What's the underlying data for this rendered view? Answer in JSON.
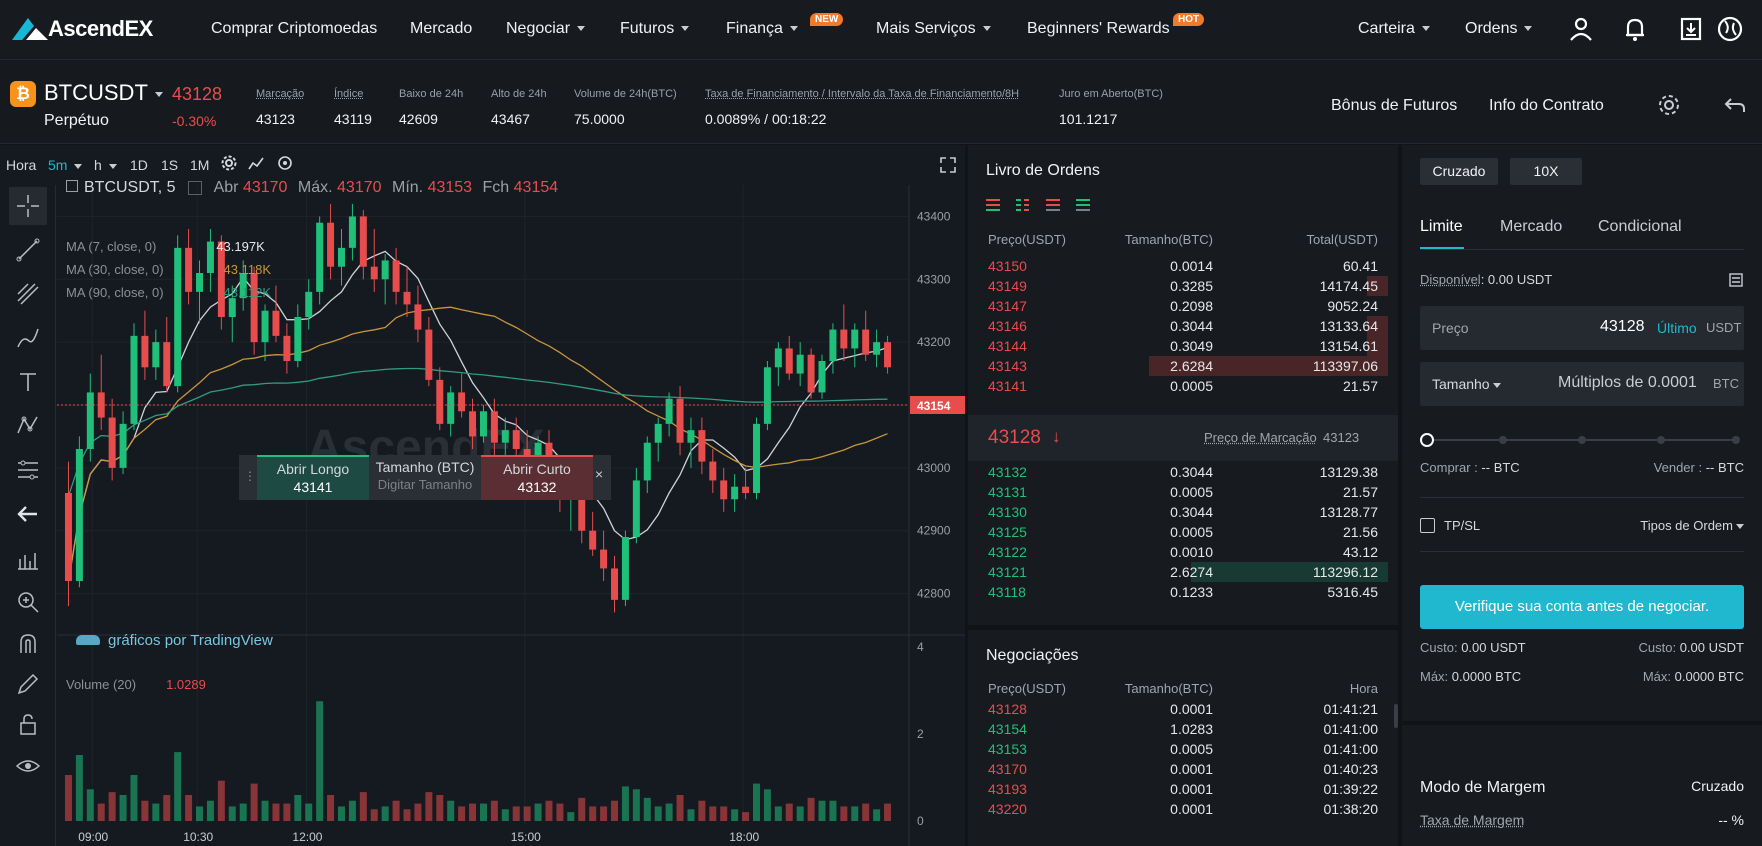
{
  "nav": {
    "logo": "AscendEX",
    "items": [
      {
        "label": "Comprar Criptomoedas"
      },
      {
        "label": "Mercado"
      },
      {
        "label": "Negociar",
        "dropdown": true
      },
      {
        "label": "Futuros",
        "dropdown": true
      },
      {
        "label": "Finança",
        "dropdown": true,
        "badge": "NEW"
      },
      {
        "label": "Mais Serviços",
        "dropdown": true
      },
      {
        "label": "Beginners' Rewards",
        "badge": "HOT"
      }
    ],
    "right": [
      {
        "label": "Carteira"
      },
      {
        "label": "Ordens"
      }
    ],
    "icons": [
      "user-icon",
      "bell-icon",
      "download-icon",
      "globe-icon"
    ]
  },
  "ticker": {
    "symbol": "BTCUSDT",
    "type": "Perpétuo",
    "price": "43128",
    "change": "-0.30%",
    "stats": [
      {
        "label": "Marcação",
        "value": "43123"
      },
      {
        "label": "Índice",
        "value": "43119"
      },
      {
        "label": "Baixo de 24h",
        "value": "42609"
      },
      {
        "label": "Alto de 24h",
        "value": "43467"
      },
      {
        "label": "Volume de 24h(BTC)",
        "value": "75.0000"
      },
      {
        "label": "Taxa de Financiamento / Intervalo da Taxa de Financiamento/8H",
        "value": "0.0089% / 00:18:22"
      },
      {
        "label": "Juro em Aberto(BTC)",
        "value": "101.1217"
      }
    ],
    "links": [
      "Bônus de Futuros",
      "Info do Contrato"
    ]
  },
  "chart": {
    "timeframes": [
      "Hora",
      "5m",
      "h",
      "1D",
      "1S",
      "1M"
    ],
    "legend_title": "BTCUSDT, 5",
    "ohlc": {
      "abr_label": "Abr",
      "abr": "43170",
      "max_label": "Máx.",
      "max": "43170",
      "min_label": "Mín.",
      "min": "43153",
      "fch_label": "Fch",
      "fch": "43154"
    },
    "ma": [
      {
        "label": "MA (7, close, 0)",
        "value": "43.197K",
        "color": "#cfd3d8"
      },
      {
        "label": "MA (30, close, 0)",
        "value": "43.118K",
        "color": "#c8963c"
      },
      {
        "label": "MA (90, close, 0)",
        "value": "43.112K",
        "color": "#2f9c82"
      }
    ],
    "price_axis": [
      "43400",
      "43300",
      "43200",
      "43100",
      "43000",
      "42900",
      "42800"
    ],
    "current_price_tag": "43154",
    "time_axis": [
      "09:00",
      "10:30",
      "12:00",
      "15:00",
      "18:00"
    ],
    "volume_label": "Volume (20)",
    "volume_value": "1.0289",
    "volume_axis": [
      "4",
      "2",
      "0"
    ],
    "attribution": "gráficos por TradingView",
    "quick_trade": {
      "long_label": "Abrir Longo",
      "long_price": "43141",
      "size_label": "Tamanho (BTC)",
      "size_placeholder": "Digitar Tamanho",
      "short_label": "Abrir Curto",
      "short_price": "43132"
    }
  },
  "chart_data": {
    "type": "candlestick",
    "ylim": [
      42750,
      43450
    ],
    "candles": [
      [
        42960,
        43010,
        42780,
        42820
      ],
      [
        42820,
        43050,
        42810,
        43030
      ],
      [
        43030,
        43150,
        43010,
        43120
      ],
      [
        43120,
        43180,
        43060,
        43080
      ],
      [
        43080,
        43110,
        42980,
        43000
      ],
      [
        43000,
        43090,
        42990,
        43070
      ],
      [
        43070,
        43230,
        43060,
        43210
      ],
      [
        43210,
        43250,
        43140,
        43160
      ],
      [
        43160,
        43220,
        43140,
        43200
      ],
      [
        43200,
        43240,
        43120,
        43130
      ],
      [
        43130,
        43370,
        43120,
        43350
      ],
      [
        43350,
        43380,
        43260,
        43280
      ],
      [
        43280,
        43330,
        43230,
        43310
      ],
      [
        43310,
        43380,
        43280,
        43360
      ],
      [
        43360,
        43370,
        43220,
        43240
      ],
      [
        43240,
        43290,
        43200,
        43270
      ],
      [
        43270,
        43330,
        43250,
        43310
      ],
      [
        43310,
        43320,
        43180,
        43200
      ],
      [
        43200,
        43260,
        43170,
        43250
      ],
      [
        43250,
        43290,
        43200,
        43210
      ],
      [
        43210,
        43230,
        43150,
        43170
      ],
      [
        43170,
        43260,
        43160,
        43240
      ],
      [
        43240,
        43300,
        43220,
        43280
      ],
      [
        43280,
        43400,
        43260,
        43390
      ],
      [
        43390,
        43420,
        43300,
        43320
      ],
      [
        43320,
        43380,
        43290,
        43350
      ],
      [
        43350,
        43420,
        43330,
        43400
      ],
      [
        43400,
        43410,
        43300,
        43320
      ],
      [
        43320,
        43380,
        43280,
        43300
      ],
      [
        43300,
        43340,
        43260,
        43330
      ],
      [
        43330,
        43350,
        43260,
        43280
      ],
      [
        43280,
        43320,
        43240,
        43260
      ],
      [
        43260,
        43290,
        43200,
        43220
      ],
      [
        43220,
        43240,
        43130,
        43140
      ],
      [
        43140,
        43160,
        43060,
        43070
      ],
      [
        43070,
        43130,
        43050,
        43120
      ],
      [
        43120,
        43150,
        43080,
        43090
      ],
      [
        43090,
        43110,
        43030,
        43050
      ],
      [
        43050,
        43100,
        43040,
        43090
      ],
      [
        43090,
        43110,
        43020,
        43040
      ],
      [
        43040,
        43080,
        43000,
        43060
      ],
      [
        43060,
        43080,
        43010,
        43030
      ],
      [
        43030,
        43060,
        42990,
        43000
      ],
      [
        43000,
        43050,
        42960,
        43040
      ],
      [
        43040,
        43060,
        42980,
        42990
      ],
      [
        42990,
        43010,
        42930,
        42950
      ],
      [
        42950,
        42980,
        42900,
        42960
      ],
      [
        42960,
        42970,
        42880,
        42900
      ],
      [
        42900,
        42930,
        42860,
        42870
      ],
      [
        42870,
        42900,
        42820,
        42840
      ],
      [
        42840,
        42860,
        42770,
        42790
      ],
      [
        42790,
        42900,
        42780,
        42890
      ],
      [
        42890,
        43000,
        42880,
        42980
      ],
      [
        42980,
        43050,
        42960,
        43040
      ],
      [
        43040,
        43080,
        43010,
        43070
      ],
      [
        43070,
        43120,
        43050,
        43110
      ],
      [
        43110,
        43130,
        43020,
        43040
      ],
      [
        43040,
        43080,
        43000,
        43060
      ],
      [
        43060,
        43080,
        42990,
        43010
      ],
      [
        43010,
        43030,
        42960,
        42980
      ],
      [
        42980,
        43000,
        42930,
        42950
      ],
      [
        42950,
        42990,
        42930,
        42970
      ],
      [
        42970,
        43000,
        42950,
        42960
      ],
      [
        42960,
        43080,
        42950,
        43070
      ],
      [
        43070,
        43170,
        43060,
        43160
      ],
      [
        43160,
        43200,
        43130,
        43190
      ],
      [
        43190,
        43210,
        43140,
        43150
      ],
      [
        43150,
        43200,
        43130,
        43180
      ],
      [
        43180,
        43190,
        43110,
        43120
      ],
      [
        43120,
        43180,
        43110,
        43170
      ],
      [
        43170,
        43230,
        43150,
        43220
      ],
      [
        43220,
        43260,
        43170,
        43190
      ],
      [
        43190,
        43230,
        43160,
        43220
      ],
      [
        43220,
        43250,
        43170,
        43180
      ],
      [
        43180,
        43220,
        43160,
        43200
      ],
      [
        43200,
        43210,
        43150,
        43160
      ]
    ],
    "volume_max": 4
  },
  "orderbook": {
    "title": "Livro de Ordens",
    "headers": [
      "Preço(USDT)",
      "Tamanho(BTC)",
      "Total(USDT)"
    ],
    "asks": [
      {
        "price": "43150",
        "size": "0.0014",
        "total": "60.41",
        "depth": 0
      },
      {
        "price": "43149",
        "size": "0.3285",
        "total": "14174.45",
        "depth": 0.05
      },
      {
        "price": "43147",
        "size": "0.2098",
        "total": "9052.24",
        "depth": 0
      },
      {
        "price": "43146",
        "size": "0.3044",
        "total": "13133.64",
        "depth": 0.05
      },
      {
        "price": "43144",
        "size": "0.3049",
        "total": "13154.61",
        "depth": 0.05
      },
      {
        "price": "43143",
        "size": "2.6284",
        "total": "113397.06",
        "depth": 0.57
      },
      {
        "price": "43141",
        "size": "0.0005",
        "total": "21.57",
        "depth": 0
      }
    ],
    "last_price": "43128",
    "mark_label": "Preço de Marcação",
    "mark_price": "43123",
    "bids": [
      {
        "price": "43132",
        "size": "0.3044",
        "total": "13129.38",
        "depth": 0
      },
      {
        "price": "43131",
        "size": "0.0005",
        "total": "21.57",
        "depth": 0
      },
      {
        "price": "43130",
        "size": "0.3044",
        "total": "13128.77",
        "depth": 0
      },
      {
        "price": "43125",
        "size": "0.0005",
        "total": "21.56",
        "depth": 0
      },
      {
        "price": "43122",
        "size": "0.0010",
        "total": "43.12",
        "depth": 0
      },
      {
        "price": "43121",
        "size": "2.6274",
        "total": "113296.12",
        "depth": 0.47
      },
      {
        "price": "43118",
        "size": "0.1233",
        "total": "5316.45",
        "depth": 0
      }
    ]
  },
  "trades": {
    "title": "Negociações",
    "headers": [
      "Preço(USDT)",
      "Tamanho(BTC)",
      "Hora"
    ],
    "rows": [
      {
        "price": "43128",
        "size": "0.0001",
        "time": "01:41:21",
        "side": "red"
      },
      {
        "price": "43154",
        "size": "1.0283",
        "time": "01:41:00",
        "side": "green"
      },
      {
        "price": "43153",
        "size": "0.0005",
        "time": "01:41:00",
        "side": "green"
      },
      {
        "price": "43170",
        "size": "0.0001",
        "time": "01:40:23",
        "side": "red"
      },
      {
        "price": "43193",
        "size": "0.0001",
        "time": "01:39:22",
        "side": "red"
      },
      {
        "price": "43220",
        "size": "0.0001",
        "time": "01:38:20",
        "side": "red"
      }
    ]
  },
  "orderform": {
    "margin_mode": "Cruzado",
    "leverage": "10X",
    "tabs": [
      "Limite",
      "Mercado",
      "Condicional"
    ],
    "available_label": "Disponível",
    "available": ": 0.00 USDT",
    "price_label": "Preço",
    "price_value": "43128",
    "price_ultimo": "Último",
    "price_unit": "USDT",
    "size_label": "Tamanho",
    "size_placeholder": "Múltiplos de 0.0001",
    "size_unit": "BTC",
    "buy_label": "Comprar :",
    "buy_value": "-- BTC",
    "sell_label": "Vender :",
    "sell_value": "-- BTC",
    "tpsl": "TP/SL",
    "order_types": "Tipos de Ordem",
    "verify_button": "Verifique sua conta antes de negociar.",
    "cost_label": "Custo:",
    "cost_left": "0.00 USDT",
    "cost_right": "0.00 USDT",
    "max_label": "Máx:",
    "max_left": "0.0000 BTC",
    "max_right": "0.0000 BTC",
    "margin_mode_title": "Modo de Margem",
    "margin_mode_value": "Cruzado",
    "margin_rate_label": "Taxa de Margem",
    "margin_rate_value": "-- %"
  },
  "colors": {
    "up": "#20c07a",
    "down": "#e84d4d",
    "accent": "#1fb8cf"
  }
}
